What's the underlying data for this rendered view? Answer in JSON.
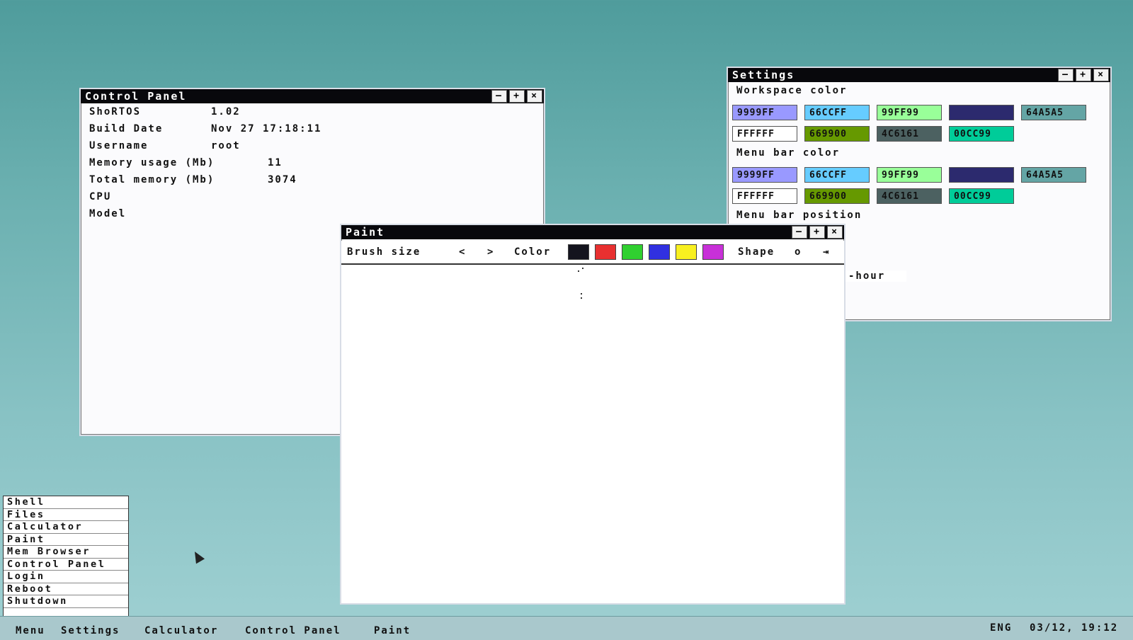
{
  "control_panel": {
    "title": "Control Panel",
    "rows": [
      {
        "label": "ShoRTOS",
        "value": "1.02"
      },
      {
        "label": "Build Date",
        "value": "Nov 27 17:18:11"
      },
      {
        "label": "Username",
        "value": "root"
      },
      {
        "label": "Memory usage (Mb)",
        "value": "11"
      },
      {
        "label": "Total memory (Mb)",
        "value": "3074"
      },
      {
        "label": "CPU",
        "value": ""
      },
      {
        "label": "Model",
        "value": ""
      }
    ]
  },
  "window_controls": {
    "minimize": "–",
    "maximize": "+",
    "close": "×"
  },
  "settings": {
    "title": "Settings",
    "workspace_label": "Workspace color",
    "menubar_label": "Menu bar color",
    "menubar_position_label": "Menu bar position",
    "hour_label": "-hour",
    "colors": [
      "9999FF",
      "66CCFF",
      "99FF99",
      "",
      "64A5A5",
      "FFFFFF",
      "669900",
      "4C6161",
      "00CC99"
    ],
    "swatch_colors": [
      "#9999ff",
      "#66ccff",
      "#99ff99",
      "#2c2a6e",
      "#64a5a5",
      "#ffffff",
      "#669900",
      "#4c6161",
      "#00cc99"
    ]
  },
  "paint": {
    "title": "Paint",
    "brush_label": "Brush size",
    "brush_prev": "<",
    "brush_next": ">",
    "color_label": "Color",
    "palette": [
      "#14141e",
      "#e83030",
      "#30d030",
      "#3030e0",
      "#f8f020",
      "#c830d8"
    ],
    "shape_label": "Shape",
    "shape_value": "o",
    "shape_next": "⇥"
  },
  "start_menu": {
    "items": [
      "Shell",
      "Files",
      "Calculator",
      "Paint",
      "Mem Browser",
      "Control Panel",
      "Login",
      "Reboot",
      "Shutdown"
    ]
  },
  "taskbar": {
    "items": [
      "Menu",
      "Settings",
      "Calculator",
      "Control Panel",
      "Paint"
    ],
    "keyboard": "ENG",
    "clock": "03/12, 19:12"
  }
}
